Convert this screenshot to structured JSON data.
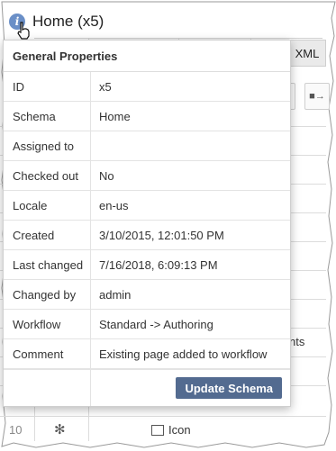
{
  "header": {
    "title": "Home (x5)",
    "info_icon": "info-icon",
    "cursor_icon": "hand-pointer-icon"
  },
  "background": {
    "tab_xml": "XML",
    "partial_text": "nts",
    "last_row": {
      "number": "10",
      "star": "✻",
      "icon_label": "Icon"
    }
  },
  "popup": {
    "title": "General Properties",
    "rows": [
      {
        "key": "ID",
        "value": "x5"
      },
      {
        "key": "Schema",
        "value": "Home"
      },
      {
        "key": "Assigned to",
        "value": ""
      },
      {
        "key": "Checked out",
        "value": "No"
      },
      {
        "key": "Locale",
        "value": "en-us"
      },
      {
        "key": "Created",
        "value": "3/10/2015, 12:01:50 PM"
      },
      {
        "key": "Last changed",
        "value": "7/16/2018, 6:09:13 PM"
      },
      {
        "key": "Changed by",
        "value": "admin"
      },
      {
        "key": "Workflow",
        "value": "Standard -> Authoring"
      },
      {
        "key": "Comment",
        "value": "Existing page added to workflow"
      }
    ],
    "update_button": "Update Schema",
    "link_color": "#2e7fb8",
    "button_color": "#536b90"
  }
}
